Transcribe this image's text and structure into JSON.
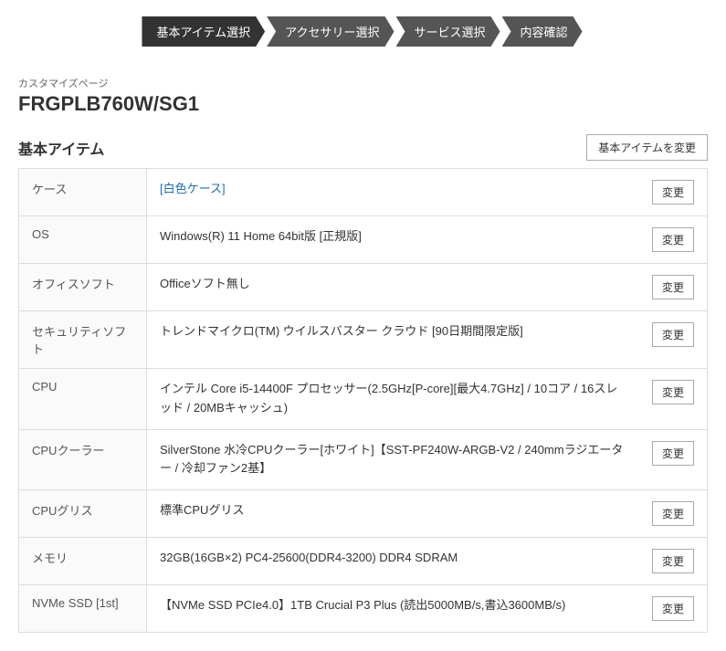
{
  "breadcrumb": {
    "page_label": "カスタマイズページ",
    "product_title": "FRGPLB760W/SG1",
    "steps": [
      {
        "label": "基本アイテム選択",
        "active": true
      },
      {
        "label": "アクセサリー選択",
        "active": false
      },
      {
        "label": "サービス選択",
        "active": false
      },
      {
        "label": "内容確認",
        "active": false
      }
    ]
  },
  "section": {
    "title": "基本アイテム",
    "change_button": "基本アイテムを変更"
  },
  "rows": [
    {
      "label": "ケース",
      "value": "[白色ケース]",
      "is_link": true,
      "button": "変更"
    },
    {
      "label": "OS",
      "value": "Windows(R) 11 Home 64bit版 [正規版]",
      "is_link": false,
      "button": "変更"
    },
    {
      "label": "オフィスソフト",
      "value": "Officeソフト無し",
      "is_link": false,
      "button": "変更"
    },
    {
      "label": "セキュリティソフト",
      "value": "トレンドマイクロ(TM) ウイルスバスター クラウド [90日期間限定版]",
      "is_link": false,
      "button": "変更"
    },
    {
      "label": "CPU",
      "value": "インテル Core i5-14400F プロセッサー(2.5GHz[P-core][最大4.7GHz] / 10コア / 16スレッド / 20MBキャッシュ)",
      "is_link": false,
      "button": "変更"
    },
    {
      "label": "CPUクーラー",
      "value": "SilverStone 水冷CPUクーラー[ホワイト]【SST-PF240W-ARGB-V2 / 240mmラジエーター / 冷却ファン2基】",
      "is_link": false,
      "button": "変更"
    },
    {
      "label": "CPUグリス",
      "value": "標準CPUグリス",
      "is_link": false,
      "button": "変更"
    },
    {
      "label": "メモリ",
      "value": "32GB(16GB×2) PC4-25600(DDR4-3200) DDR4 SDRAM",
      "is_link": false,
      "button": "変更"
    },
    {
      "label": "NVMe SSD [1st]",
      "value": "【NVMe SSD PCIe4.0】1TB Crucial P3 Plus (読出5000MB/s,書込3600MB/s)",
      "is_link": false,
      "button": "変更"
    }
  ]
}
